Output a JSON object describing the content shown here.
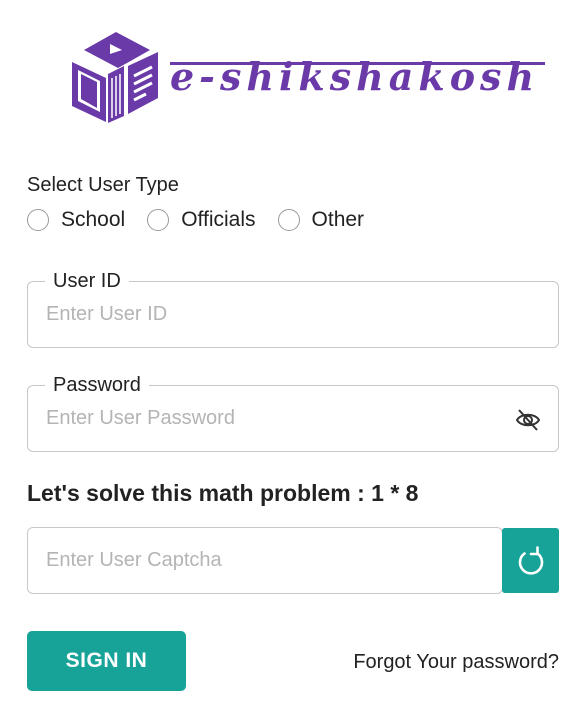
{
  "brand": {
    "logo_icon": "book-cube-icon",
    "logo_text": "e-shikshakosh",
    "logo_color": "#6a3aa8"
  },
  "user_type": {
    "label": "Select User Type",
    "options": [
      "School",
      "Officials",
      "Other"
    ]
  },
  "user_id": {
    "legend": "User ID",
    "placeholder": "Enter User ID"
  },
  "password": {
    "legend": "Password",
    "placeholder": "Enter User Password",
    "toggle_icon": "eye-off-icon"
  },
  "captcha": {
    "question": "Let's solve this math problem : 1 * 8",
    "placeholder": "Enter User Captcha",
    "refresh_icon": "refresh-icon"
  },
  "actions": {
    "signin_label": "SIGN IN",
    "forgot_label": "Forgot Your password?",
    "accent_color": "#17a398"
  }
}
